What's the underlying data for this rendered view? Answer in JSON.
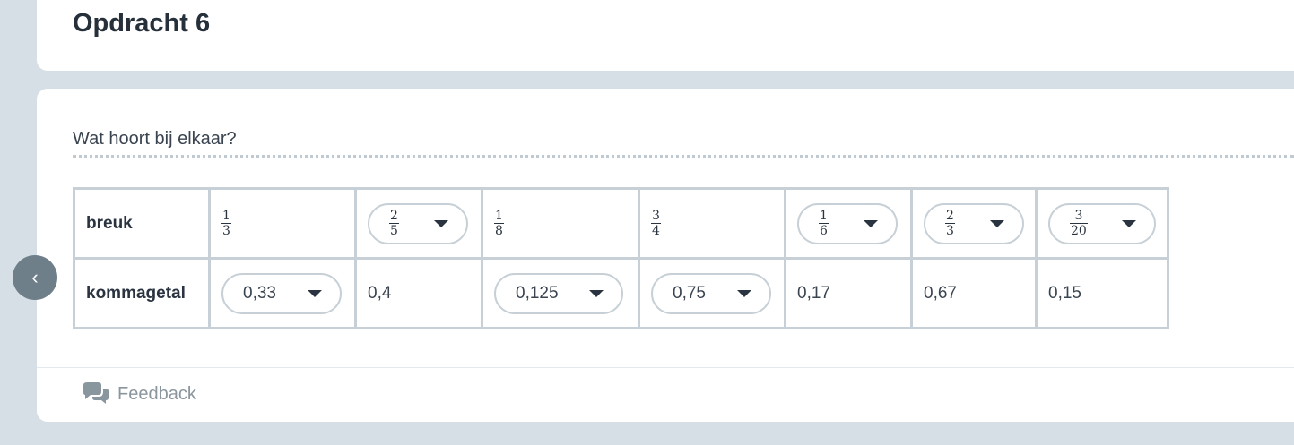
{
  "header": {
    "title": "Opdracht 6"
  },
  "question": "Wat hoort bij elkaar?",
  "table": {
    "row_labels": [
      "breuk",
      "kommagetal"
    ],
    "breuk": [
      {
        "type": "fraction",
        "num": "1",
        "den": "3"
      },
      {
        "type": "dropdown-fraction",
        "num": "2",
        "den": "5"
      },
      {
        "type": "fraction",
        "num": "1",
        "den": "8"
      },
      {
        "type": "fraction",
        "num": "3",
        "den": "4"
      },
      {
        "type": "dropdown-fraction",
        "num": "1",
        "den": "6"
      },
      {
        "type": "dropdown-fraction",
        "num": "2",
        "den": "3"
      },
      {
        "type": "dropdown-fraction",
        "num": "3",
        "den": "20"
      }
    ],
    "kommagetal": [
      {
        "type": "dropdown",
        "value": "0,33"
      },
      {
        "type": "text",
        "value": "0,4"
      },
      {
        "type": "dropdown",
        "value": "0,125"
      },
      {
        "type": "dropdown",
        "value": "0,75"
      },
      {
        "type": "text",
        "value": "0,17"
      },
      {
        "type": "text",
        "value": "0,67"
      },
      {
        "type": "text",
        "value": "0,15"
      }
    ]
  },
  "nav": {
    "prev_icon": "chevron-left-icon",
    "prev_glyph": "‹"
  },
  "footer": {
    "feedback_label": "Feedback",
    "feedback_icon": "chat-bubbles-icon"
  }
}
